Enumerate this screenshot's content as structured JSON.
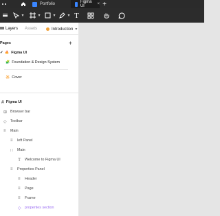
{
  "tabs": [
    {
      "label": "Portfolio"
    },
    {
      "label": "Figma UI"
    }
  ],
  "panel": {
    "tab_layers": "Layers",
    "tab_assets": "Assets",
    "tab_page": "Introduction",
    "pages_title": "Pages",
    "pages": [
      {
        "label": "Figma UI",
        "emoji": "🔥"
      },
      {
        "label": "Foundation & Design System",
        "emoji": "🧩"
      },
      {
        "label": "Cover",
        "emoji": "🔆"
      }
    ],
    "frame_title": "Figma UI",
    "layers": [
      {
        "label": "Browser bar"
      },
      {
        "label": "Toolbar"
      },
      {
        "label": "Main"
      },
      {
        "label": "left Panel"
      },
      {
        "label": "Main"
      },
      {
        "label": "Welcome to Figma UI"
      },
      {
        "label": "Properties Panel"
      },
      {
        "label": "Header"
      },
      {
        "label": "Page"
      },
      {
        "label": "Frame"
      },
      {
        "label": "properties section"
      }
    ]
  },
  "colors": {
    "accent": "#3a86ff",
    "purple": "#9b6ef3",
    "dark": "#2c2c2c"
  }
}
